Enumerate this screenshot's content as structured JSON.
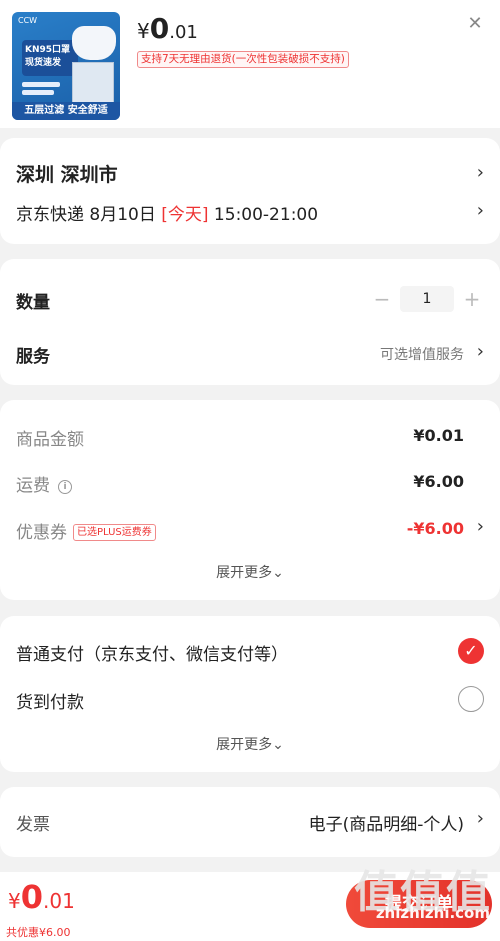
{
  "product": {
    "brand": "CCW",
    "badge_line1": "KN95口罩",
    "badge_line2": "现货速发",
    "banner": "五层过滤  安全舒适",
    "price_currency": "¥",
    "price_int": "0",
    "price_dec": ".01",
    "refund_notice": "支持7天无理由退货(一次性包装破损不支持)"
  },
  "address": {
    "text": "深圳  深圳市",
    "delivery_prefix": "京东快递 8月10日 ",
    "delivery_today": "[今天]",
    "delivery_time": " 15:00-21:00"
  },
  "quantity": {
    "label": "数量",
    "minus": "−",
    "value": "1",
    "plus": "+"
  },
  "service": {
    "label": "服务",
    "hint": "可选增值服务"
  },
  "costs": {
    "goods_label": "商品金额",
    "goods_value": "¥0.01",
    "shipping_label": "运费",
    "shipping_value": "¥6.00",
    "coupon_label": "优惠券",
    "coupon_tag": "已选PLUS运费券",
    "coupon_value": "-¥6.00",
    "more": "展开更多⌄"
  },
  "payment": {
    "online_label": "普通支付（京东支付、微信支付等）",
    "cod_label": "货到付款",
    "more": "展开更多⌄"
  },
  "invoice": {
    "label": "发票",
    "value": "电子(商品明细-个人)"
  },
  "footer": {
    "currency": "¥",
    "int": "0",
    "dec": ".01",
    "discount": "共优惠¥6.00",
    "submit": "提交订单"
  },
  "watermark": {
    "big": "值值值",
    "small": "zhizhizhi.com"
  },
  "colors": {
    "accent": "#e33a2a"
  }
}
